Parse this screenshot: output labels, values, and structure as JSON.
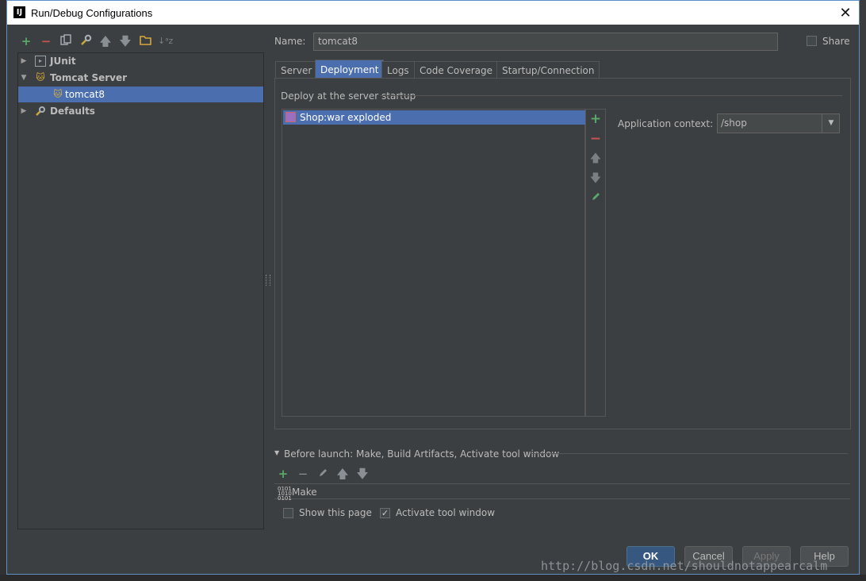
{
  "window": {
    "title": "Run/Debug Configurations",
    "app_icon_text": "IJ"
  },
  "toolbar": {
    "icons": [
      "add-icon",
      "remove-icon",
      "copy-icon",
      "edit-defaults-icon",
      "move-up-icon",
      "move-down-icon",
      "folder-icon",
      "sort-icon"
    ]
  },
  "tree": {
    "items": [
      {
        "label": "JUnit",
        "icon": "junit-icon",
        "expanded": false
      },
      {
        "label": "Tomcat Server",
        "icon": "tomcat-icon",
        "expanded": true
      },
      {
        "label": "tomcat8",
        "icon": "tomcat-icon",
        "selected": true
      },
      {
        "label": "Defaults",
        "icon": "wrench-icon",
        "expanded": false
      }
    ]
  },
  "config": {
    "name_label": "Name:",
    "name_value": "tomcat8",
    "share_label": "Share"
  },
  "tabs": [
    {
      "label": "Server"
    },
    {
      "label": "Deployment",
      "active": true
    },
    {
      "label": "Logs"
    },
    {
      "label": "Code Coverage"
    },
    {
      "label": "Startup/Connection"
    }
  ],
  "deployment": {
    "section_label": "Deploy at the server startup",
    "artifacts": [
      "Shop:war exploded"
    ],
    "context_label": "Application context:",
    "context_value": "/shop"
  },
  "before_launch": {
    "label": "Before launch: Make, Build Artifacts, Activate tool window",
    "tasks": [
      "Make"
    ],
    "make_icon_text": "0101\n1010\n0101"
  },
  "options": {
    "show_page_label": "Show this page",
    "show_page_checked": false,
    "activate_label": "Activate tool window",
    "activate_checked": true
  },
  "buttons": {
    "ok": "OK",
    "cancel": "Cancel",
    "apply": "Apply",
    "help": "Help"
  },
  "watermark": "http://blog.csdn.net/shouldnotappearcalm",
  "colors": {
    "selection": "#4b6eaf",
    "panel": "#3c3f41",
    "add_green": "#59a869",
    "remove_red": "#c75450"
  }
}
